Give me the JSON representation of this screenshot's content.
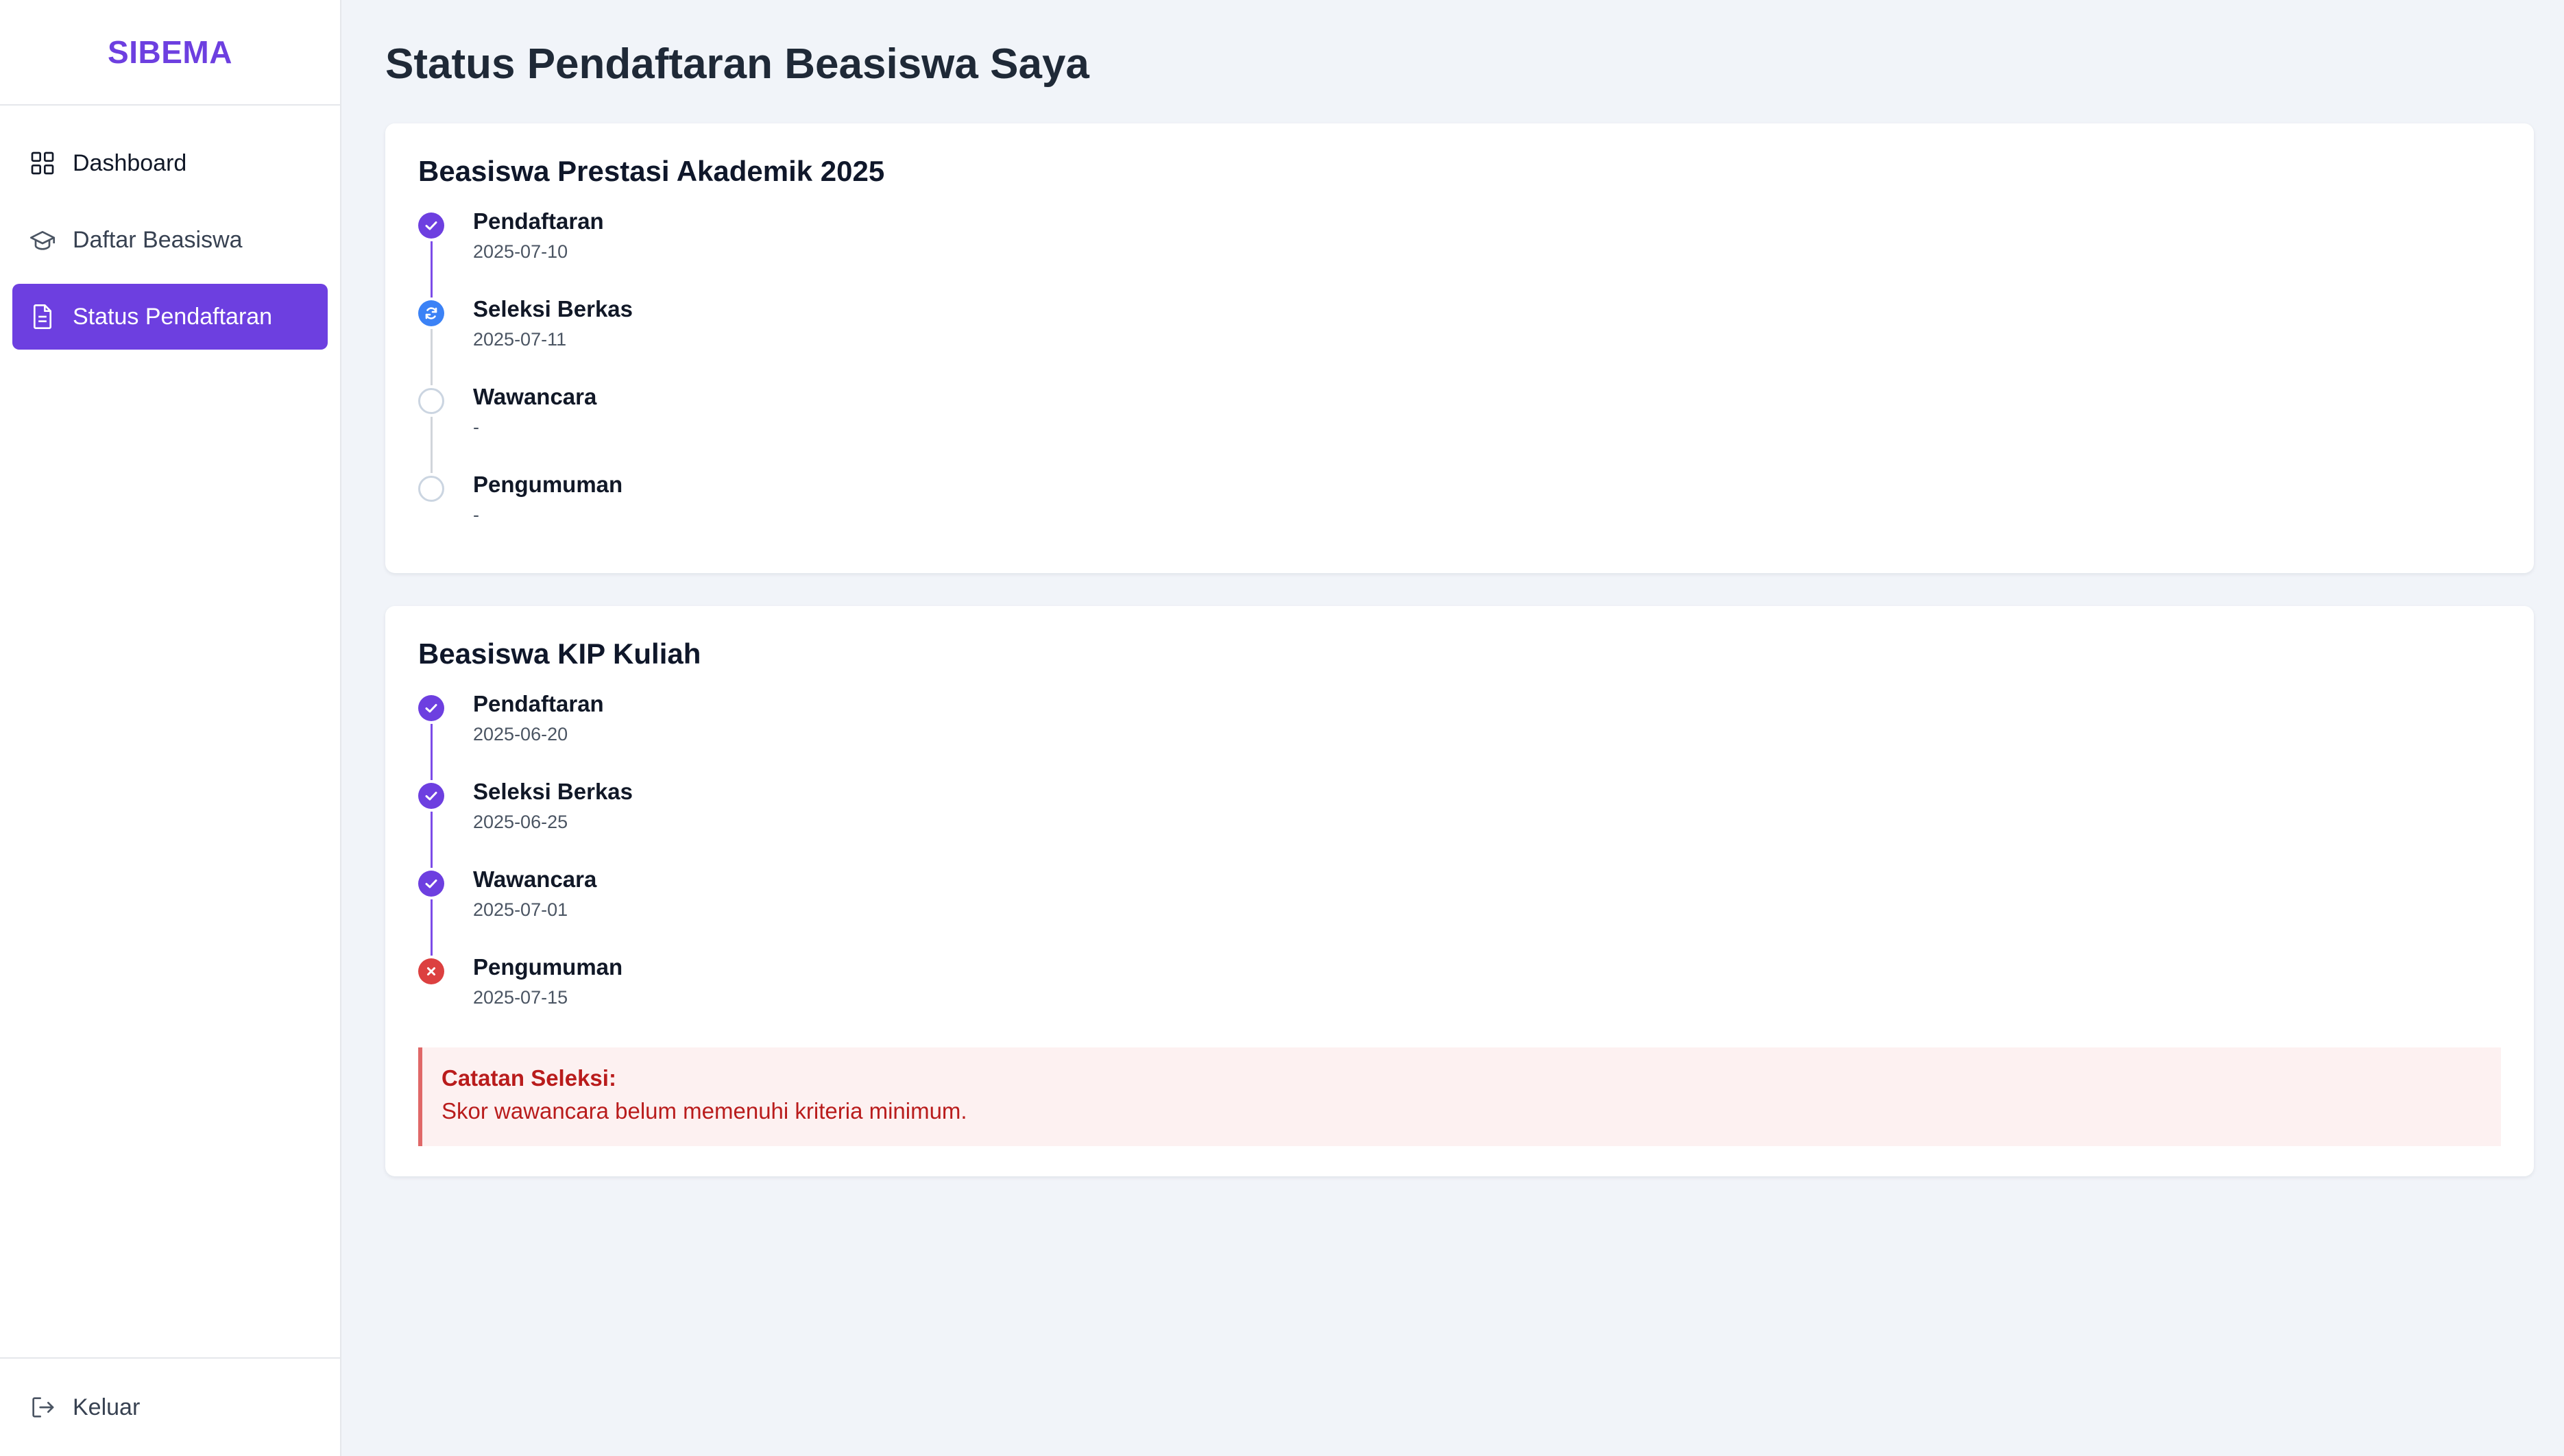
{
  "app": {
    "brand": "SIBEMA"
  },
  "sidebar": {
    "items": [
      {
        "label": "Dashboard",
        "icon": "dashboard-grid-icon",
        "active": false
      },
      {
        "label": "Daftar Beasiswa",
        "icon": "graduation-cap-icon",
        "active": false
      },
      {
        "label": "Status Pendaftaran",
        "icon": "document-icon",
        "active": true
      }
    ],
    "logout": {
      "label": "Keluar",
      "icon": "logout-icon"
    }
  },
  "main": {
    "title": "Status Pendaftaran Beasiswa Saya",
    "scholarships": [
      {
        "name": "Beasiswa Prestasi Akademik 2025",
        "steps": [
          {
            "label": "Pendaftaran",
            "date": "2025-07-10",
            "status": "done"
          },
          {
            "label": "Seleksi Berkas",
            "date": "2025-07-11",
            "status": "in-progress"
          },
          {
            "label": "Wawancara",
            "date": "-",
            "status": "pending"
          },
          {
            "label": "Pengumuman",
            "date": "-",
            "status": "pending"
          }
        ]
      },
      {
        "name": "Beasiswa KIP Kuliah",
        "steps": [
          {
            "label": "Pendaftaran",
            "date": "2025-06-20",
            "status": "done"
          },
          {
            "label": "Seleksi Berkas",
            "date": "2025-06-25",
            "status": "done"
          },
          {
            "label": "Wawancara",
            "date": "2025-07-01",
            "status": "done"
          },
          {
            "label": "Pengumuman",
            "date": "2025-07-15",
            "status": "failed"
          }
        ],
        "note": {
          "title": "Catatan Seleksi:",
          "text": "Skor wawancara belum memenuhi kriteria minimum."
        }
      }
    ]
  },
  "colors": {
    "accent": "#6d3fe0",
    "in_progress": "#3b82f6",
    "failed": "#dc4040",
    "pending_border": "#cbd5e1",
    "note_background": "#fdf1f1"
  }
}
